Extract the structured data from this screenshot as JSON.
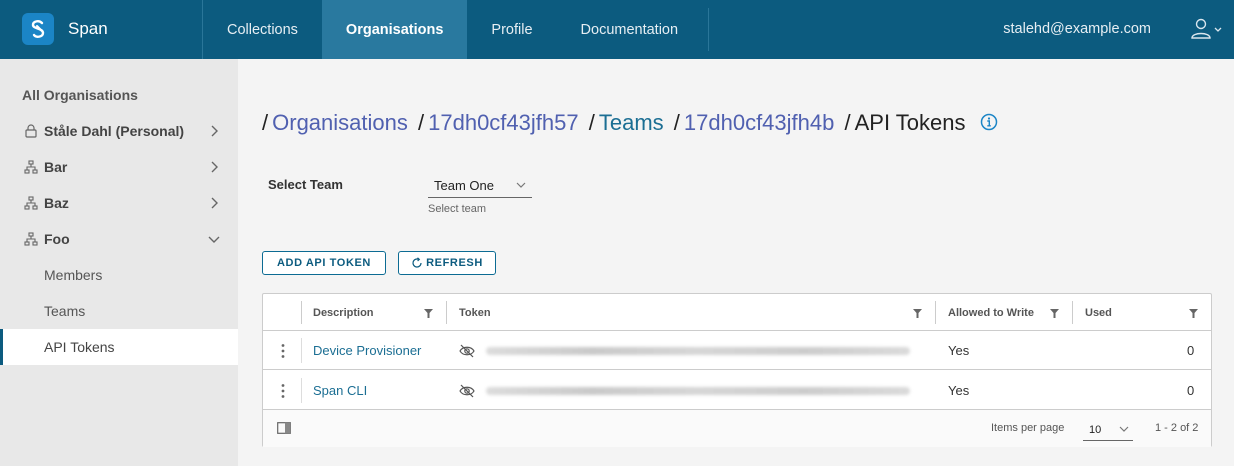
{
  "app": {
    "brand": "Span"
  },
  "nav": {
    "items": [
      {
        "label": "Collections"
      },
      {
        "label": "Organisations",
        "active": true
      },
      {
        "label": "Profile"
      },
      {
        "label": "Documentation"
      }
    ],
    "user_email": "stalehd@example.com"
  },
  "sidebar": {
    "title": "All Organisations",
    "items": [
      {
        "label": "Ståle Dahl (Personal)",
        "icon": "lock-icon",
        "expanded": false
      },
      {
        "label": "Bar",
        "icon": "org-tree-icon",
        "expanded": false
      },
      {
        "label": "Baz",
        "icon": "org-tree-icon",
        "expanded": false
      },
      {
        "label": "Foo",
        "icon": "org-tree-icon",
        "expanded": true
      }
    ],
    "sub_items": [
      {
        "label": "Members"
      },
      {
        "label": "Teams"
      },
      {
        "label": "API Tokens",
        "active": true
      }
    ]
  },
  "breadcrumb": {
    "organisations": "Organisations",
    "org_id": "17dh0cf43jfh57",
    "teams": "Teams",
    "team_id": "17dh0cf43jfh4b",
    "current": "API Tokens"
  },
  "team_select": {
    "label": "Select Team",
    "value": "Team One",
    "helper": "Select team"
  },
  "buttons": {
    "add": "ADD API TOKEN",
    "refresh": "REFRESH"
  },
  "grid": {
    "columns": {
      "description": "Description",
      "token": "Token",
      "allowed_to_write": "Allowed to Write",
      "used": "Used"
    },
    "rows": [
      {
        "description": "Device Provisioner",
        "allowed_to_write": "Yes",
        "used": "0"
      },
      {
        "description": "Span CLI",
        "allowed_to_write": "Yes",
        "used": "0"
      }
    ],
    "footer": {
      "items_per_page_label": "Items per page",
      "items_per_page": "10",
      "pagination": "1 - 2 of 2"
    }
  },
  "colors": {
    "header_bg": "#0c5b7f",
    "nav_active_bg": "#29799f",
    "link": "#5060b0",
    "link_teal": "#1b6e93",
    "sidebar_bg": "#e8e8e8"
  }
}
